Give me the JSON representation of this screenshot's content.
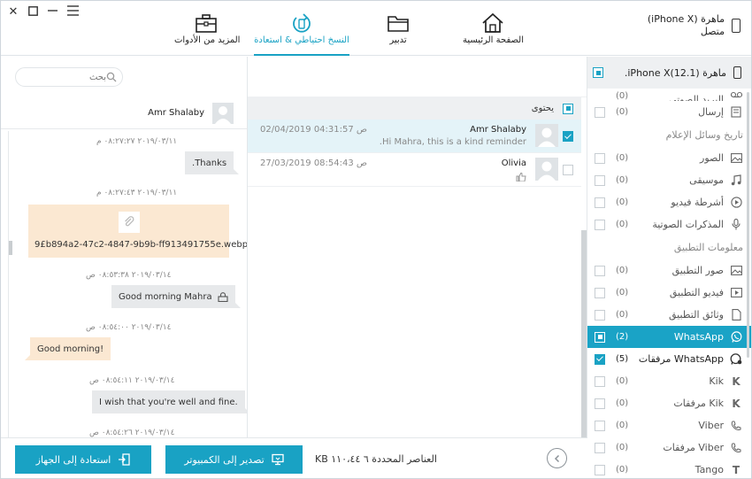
{
  "window": {
    "close_glyph": "✕",
    "maximize_glyph": "☐",
    "minimize_glyph": "—",
    "menu_glyph": "☰"
  },
  "toolbar": {
    "home_label": "الصفحة الرئيسية",
    "manage_label": "تدبير",
    "backup_label": "النسخ احتياطي & استعادة",
    "more_tools_label": "المزيد من الأدوات",
    "active": "backup"
  },
  "device": {
    "name_line1": "ماهرة (iPhone X)",
    "name_line2": "متصل"
  },
  "sidebar": {
    "device_label": "ماهرة (iPhone X(12.1.",
    "rows_top": [
      {
        "label": "البريد الصوتي",
        "count": "(0)",
        "icon": "voicemail-icon"
      },
      {
        "label": "إرسال",
        "count": "(0)",
        "icon": "send-icon"
      }
    ],
    "media_group": "تاريخ وسائل الإعلام",
    "media_rows": [
      {
        "label": "الصور",
        "count": "(0)",
        "icon": "photo-icon"
      },
      {
        "label": "موسيقى",
        "count": "(0)",
        "icon": "music-icon"
      },
      {
        "label": "أشرطة فيديو",
        "count": "(0)",
        "icon": "video-icon"
      },
      {
        "label": "المذكرات الصوتية",
        "count": "(0)",
        "icon": "microphone-icon"
      }
    ],
    "app_group": "معلومات التطبيق",
    "app_rows": [
      {
        "label": "صور التطبيق",
        "count": "(0)",
        "icon": "photo-icon"
      },
      {
        "label": "فيديو التطبيق",
        "count": "(0)",
        "icon": "video-icon"
      },
      {
        "label": "وثائق التطبيق",
        "count": "(0)",
        "icon": "document-icon"
      },
      {
        "label": "WhatsApp",
        "count": "(2)",
        "icon": "whatsapp-icon",
        "selected": true
      },
      {
        "label": "WhatsApp مرفقات",
        "count": "(5)",
        "icon": "whatsapp-attachment-icon",
        "checked": true
      },
      {
        "label": "Kik",
        "count": "(0)",
        "icon": "kik-icon"
      },
      {
        "label": "Kik مرفقات",
        "count": "(0)",
        "icon": "kik-icon"
      },
      {
        "label": "Viber",
        "count": "(0)",
        "icon": "viber-icon"
      },
      {
        "label": "Viber مرفقات",
        "count": "(0)",
        "icon": "viber-icon"
      },
      {
        "label": "Tango",
        "count": "(0)",
        "icon": "tango-icon"
      }
    ]
  },
  "conversations": {
    "header_label": "يحتوى",
    "items": [
      {
        "name": "Amr Shalaby",
        "preview": "Hi Mahra, this is a kind reminder.",
        "time": "02/04/2019 04:31:57 ص",
        "selected": true
      },
      {
        "name": "Olivia",
        "preview": "",
        "time": "27/03/2019 08:54:43 ص",
        "selected": false
      }
    ]
  },
  "search": {
    "placeholder": "بحث"
  },
  "chat": {
    "contact_name": "Amr Shalaby",
    "messages": [
      {
        "timestamp": "٢٠١٩/٠٣/١١ ٠٨:٢٧:٢٧ م",
        "text": "Thanks.",
        "side": "right"
      },
      {
        "timestamp": "٢٠١٩/٠٣/١١ ٠٨:٢٧:٤٣ م",
        "text": "9£b894a2-47c2-4847-9b9b-ff913491755e.webp",
        "side": "left",
        "attachment": true
      },
      {
        "timestamp": "٢٠١٩/٠٣/١٤ ٠٨:٥٣:٣٨ ص",
        "text": "Good morning Mahra",
        "side": "right",
        "lock": true
      },
      {
        "timestamp": "٢٠١٩/٠٣/١٤ ٠٨:٥٤:٠٠ ص",
        "text": "Good morning!",
        "side": "left"
      },
      {
        "timestamp": "٢٠١٩/٠٣/١٤ ٠٨:٥٤:١١ ص",
        "text": "I wish that you're well and fine.",
        "side": "right"
      },
      {
        "timestamp": "٢٠١٩/٠٣/١٤ ٠٨:٥٤:٢٦ ص",
        "text": "",
        "side": "right"
      }
    ]
  },
  "bottom": {
    "restore_device_label": "استعادة إلى الجهاز",
    "export_pc_label": "تصدير إلى الكمبيوتر",
    "selection_info": "العناصر المحددة ٦ ١١٠،٤٤ KB",
    "back_glyph": "‹"
  },
  "colors": {
    "accent": "#19a2c4",
    "selected_row": "#1aa3c6",
    "bubble_left": "#fbe8d2",
    "bubble_right": "#e7e9eb"
  }
}
